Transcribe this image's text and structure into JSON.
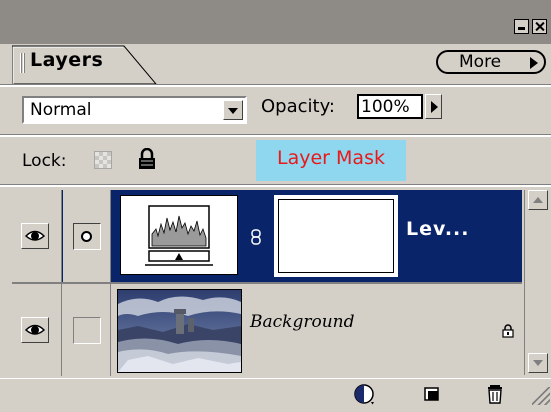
{
  "panel": {
    "tab_label": "Layers",
    "menu_button_label": "More"
  },
  "blend": {
    "mode": "Normal",
    "opacity_label": "Opacity:",
    "opacity_value": "100%"
  },
  "lock": {
    "label": "Lock:"
  },
  "annotation": {
    "text": "Layer Mask",
    "text_color": "#e8191a",
    "background": "#8fd7ef"
  },
  "layers": [
    {
      "name": "Lev...",
      "type": "adjustment-levels",
      "selected": true,
      "visible": true,
      "has_mask": true
    },
    {
      "name": "Background",
      "type": "image",
      "selected": false,
      "visible": true,
      "locked": true
    }
  ],
  "toolbar": {
    "icons": [
      "adjustment-layer-icon",
      "new-layer-icon",
      "trash-icon"
    ]
  },
  "colors": {
    "panel_bg": "#d4d0c8",
    "title_strip": "#8e8b86",
    "selection": "#0a246a",
    "selection_text": "#ffffff"
  }
}
